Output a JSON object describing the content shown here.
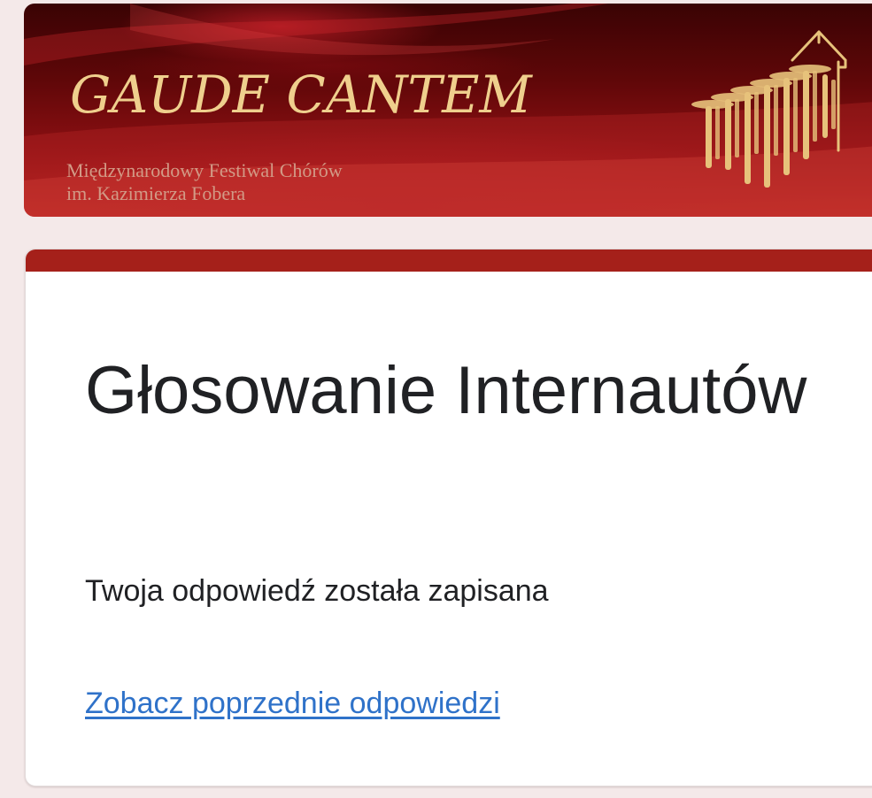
{
  "header": {
    "banner_title": "GAUDE CANTEM",
    "banner_subtitle_line1": "Międzynarodowy Festiwal Chórów",
    "banner_subtitle_line2": "im. Kazimierza Fobera",
    "logo_icon": "organ-pipes-church-icon"
  },
  "form": {
    "title": "Głosowanie Internautów",
    "confirmation": "Twoja odpowiedź została zapisana",
    "view_previous_link": "Zobacz poprzednie odpowiedzi"
  },
  "colors": {
    "accent": "#a5201a",
    "banner_gold": "#efcf8d",
    "link": "#2f72c9",
    "page_background": "#f4e9e9"
  }
}
